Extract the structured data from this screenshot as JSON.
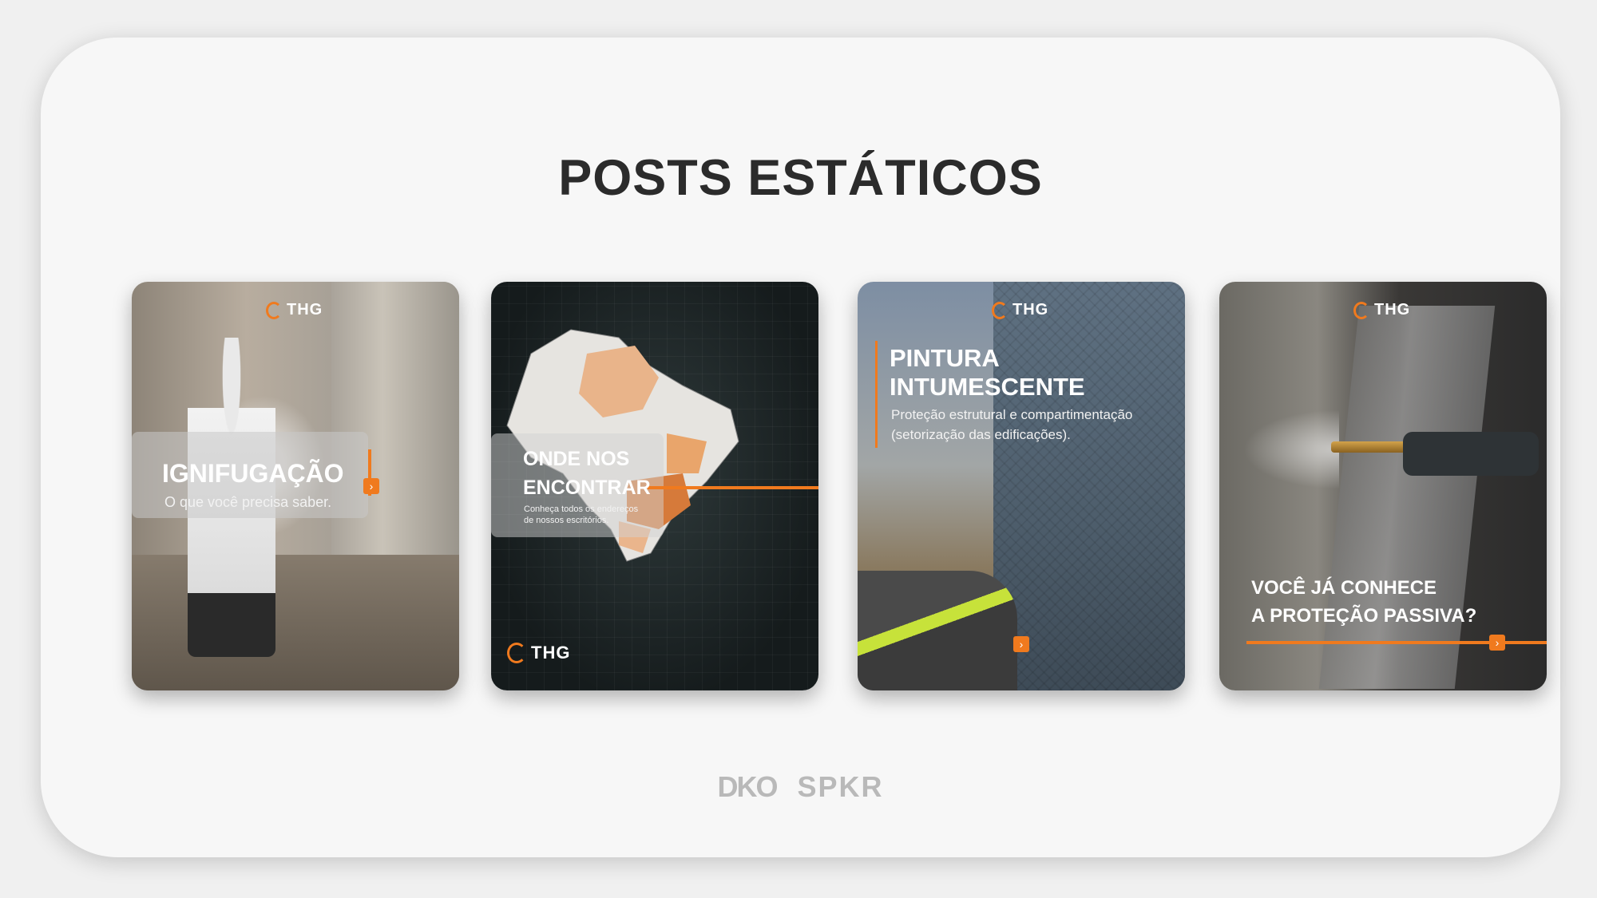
{
  "page": {
    "title": "POSTS ESTÁTICOS",
    "footer_logo": "SPKR",
    "footer_logo_mark": "DKO"
  },
  "colors": {
    "accent": "#f07a1e",
    "background": "#f7f7f7",
    "title": "#2b2b2b"
  },
  "cards": [
    {
      "brand": "THG",
      "heading": "IGNIFUGAÇÃO",
      "subheading": "O que você precisa saber.",
      "icon": "chevron-right-icon"
    },
    {
      "brand": "THG",
      "heading_line1": "ONDE NOS",
      "heading_line2": "ENCONTRAR",
      "subheading_line1": "Conheça todos os endereços",
      "subheading_line2": "de nossos escritórios."
    },
    {
      "brand": "THG",
      "heading_line1": "PINTURA",
      "heading_line2": "INTUMESCENTE",
      "subheading_line1": "Proteção estrutural e compartimentação",
      "subheading_line2": "(setorização das edificações).",
      "icon": "chevron-right-icon"
    },
    {
      "brand": "THG",
      "heading_line1": "VOCÊ JÁ CONHECE",
      "heading_line2": "A PROTEÇÃO PASSIVA?",
      "icon": "chevron-right-icon"
    }
  ]
}
